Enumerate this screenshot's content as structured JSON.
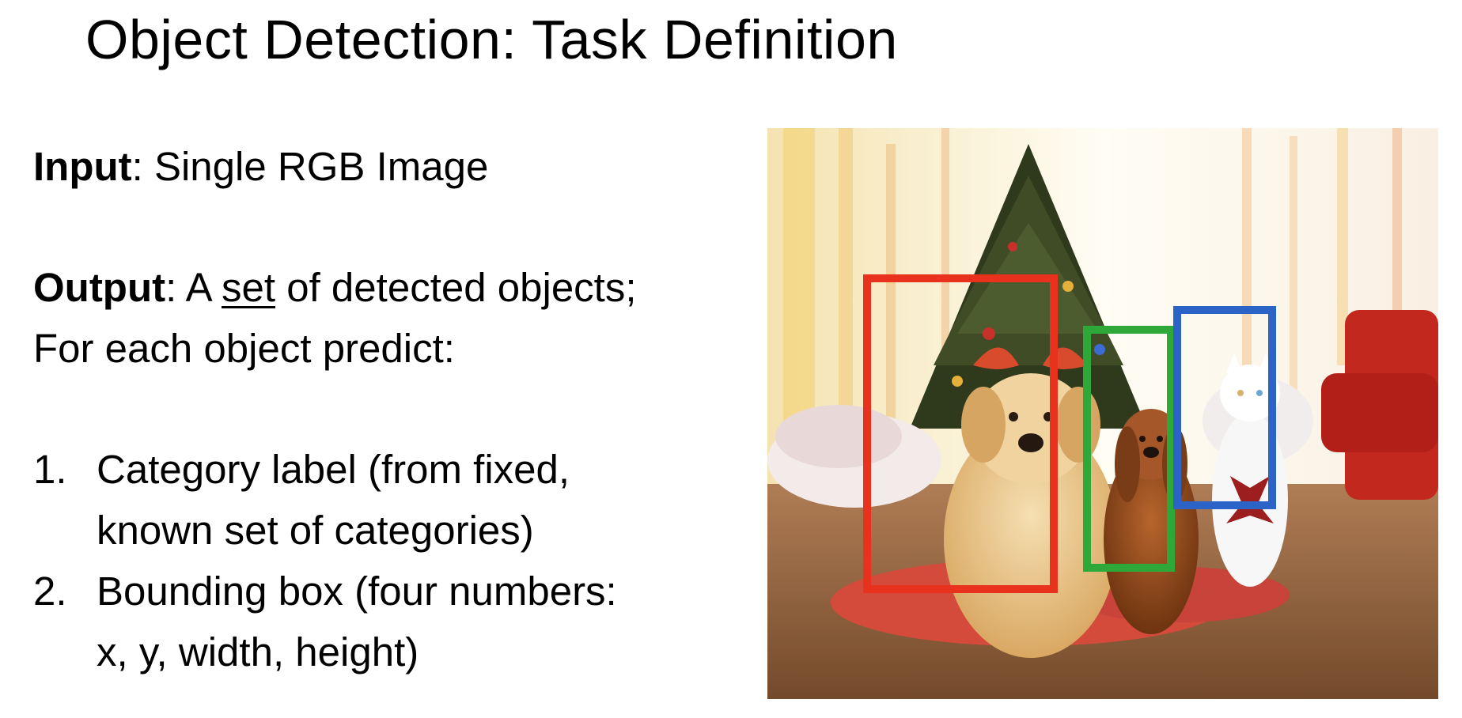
{
  "slide": {
    "title": "Object Detection: Task Definition",
    "input": {
      "label": "Input",
      "text": ": Single RGB Image"
    },
    "output": {
      "label": "Output",
      "text_before": ": A ",
      "underlined": "set",
      "text_after": " of detected objects;",
      "line2": "For each object predict:"
    },
    "list": [
      {
        "number": "1.",
        "lines": [
          "Category label (from fixed,",
          "known set of categories)"
        ]
      },
      {
        "number": "2.",
        "lines": [
          "Bounding box (four numbers:",
          "x, y, width, height)"
        ]
      }
    ]
  },
  "image": {
    "boxes": [
      {
        "name": "dog-large",
        "color": "#e8321e"
      },
      {
        "name": "dog-small",
        "color": "#2fa83a"
      },
      {
        "name": "cat",
        "color": "#2b63c6"
      }
    ]
  }
}
